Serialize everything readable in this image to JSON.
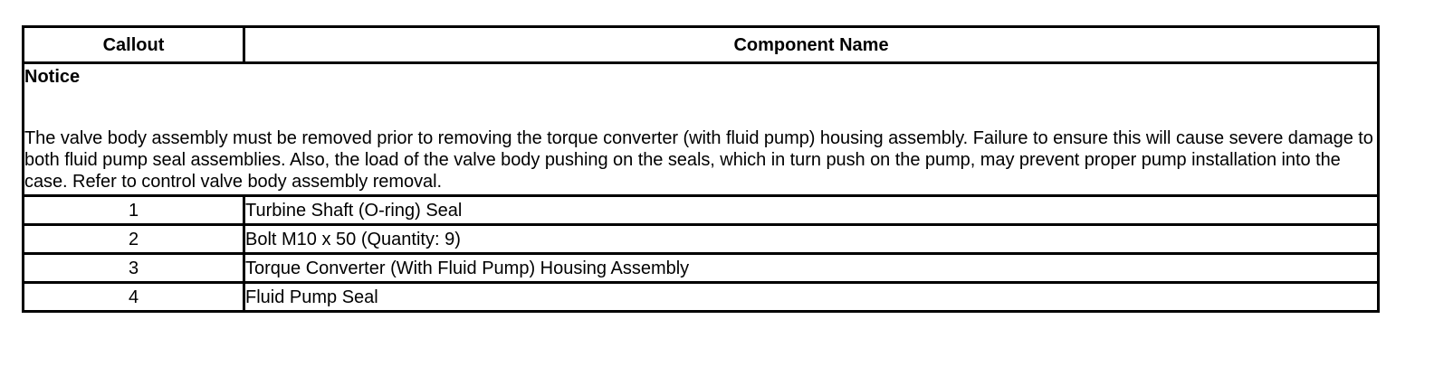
{
  "table": {
    "headers": {
      "callout": "Callout",
      "component_name": "Component Name"
    },
    "notice": {
      "title": "Notice",
      "text": "The valve body assembly must be removed prior to removing the torque converter (with fluid pump) housing assembly. Failure to ensure this will cause severe damage to both fluid pump seal assemblies. Also, the load of the valve body pushing on the seals, which in turn push on the pump, may prevent proper pump installation into the case. Refer to control valve body assembly removal."
    },
    "rows": [
      {
        "callout": "1",
        "name": "Turbine Shaft (O-ring) Seal"
      },
      {
        "callout": "2",
        "name": "Bolt M10 x 50 (Quantity: 9)"
      },
      {
        "callout": "3",
        "name": "Torque Converter (With Fluid Pump) Housing Assembly"
      },
      {
        "callout": "4",
        "name": "Fluid Pump Seal"
      }
    ]
  }
}
